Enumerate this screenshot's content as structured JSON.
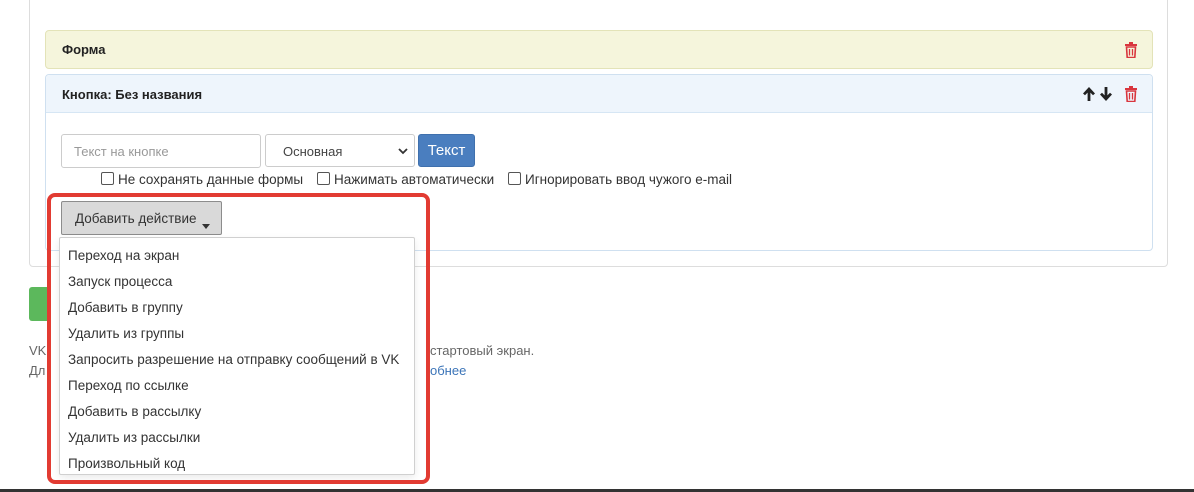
{
  "form_panel": {
    "title": "Форма"
  },
  "button_panel": {
    "title": "Кнопка: Без названия"
  },
  "button_editor": {
    "text_placeholder": "Текст на кнопке",
    "style_select_value": "Основная",
    "text_button_label": "Текст",
    "checkboxes": [
      {
        "label": "Не сохранять данные формы",
        "checked": false
      },
      {
        "label": "Нажимать автоматически",
        "checked": false
      },
      {
        "label": "Игнорировать ввод чужого e-mail",
        "checked": false
      }
    ]
  },
  "add_action": {
    "label": "Добавить действие",
    "menu_items": [
      "Переход на экран",
      "Запуск процесса",
      "Добавить в группу",
      "Удалить из группы",
      "Запросить разрешение на отправку сообщений в VK",
      "Переход по ссылке",
      "Добавить в рассылку",
      "Удалить из рассылки",
      "Произвольный код"
    ]
  },
  "footer": {
    "line1_start": "VK",
    "line1_end": "стартовый экран.",
    "line2_start": "Дл",
    "line2_link": "обнее"
  },
  "colors": {
    "form_header_bg": "#f5f5dc",
    "button_header_bg": "#eef5fc",
    "primary_button": "#4a7ebf",
    "delete_icon": "#d9363e",
    "highlight_border": "#e23b32",
    "save_button": "#5cb85c"
  },
  "icons": {
    "delete": "trash-icon",
    "move_up": "arrow-up-icon",
    "move_down": "arrow-down-icon",
    "select_caret": "chevron-down-icon",
    "dropdown_caret": "caret-down-icon"
  }
}
